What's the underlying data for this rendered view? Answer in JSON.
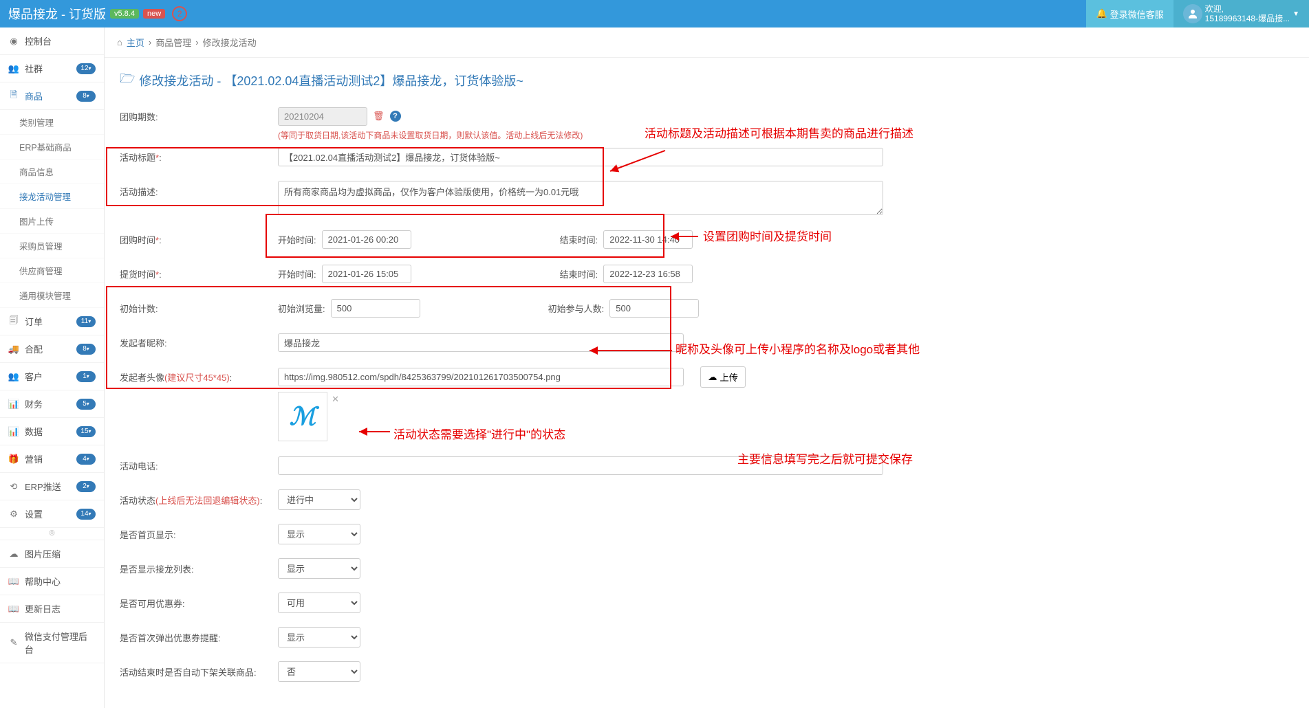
{
  "header": {
    "app_title": "爆品接龙 - 订货版",
    "version_badge": "v5.8.4",
    "new_badge": "new",
    "circle_badge": "2",
    "login_btn": "登录微信客服",
    "welcome": "欢迎,",
    "user_line": "15189963148-爆品接..."
  },
  "sidebar": {
    "items": [
      {
        "icon": "⊞",
        "label": "控制台",
        "badge": ""
      },
      {
        "icon": "👥",
        "label": "社群",
        "badge": "12"
      },
      {
        "icon": "🗎",
        "label": "商品",
        "badge": "8",
        "active": true
      },
      {
        "icon": "🗐",
        "label": "订单",
        "badge": "11"
      },
      {
        "icon": "🚚",
        "label": "合配",
        "badge": "8"
      },
      {
        "icon": "👥",
        "label": "客户",
        "badge": "1"
      },
      {
        "icon": "📊",
        "label": "财务",
        "badge": "5"
      },
      {
        "icon": "📊",
        "label": "数据",
        "badge": "15"
      },
      {
        "icon": "🎁",
        "label": "营销",
        "badge": "4"
      },
      {
        "icon": "⟲",
        "label": "ERP推送",
        "badge": "2"
      },
      {
        "icon": "⚙",
        "label": "设置",
        "badge": "14"
      }
    ],
    "subitems": [
      "类别管理",
      "ERP基础商品",
      "商品信息",
      "接龙活动管理",
      "图片上传",
      "采购员管理",
      "供应商管理",
      "通用模块管理"
    ],
    "bottom": [
      {
        "icon": "☁",
        "label": "图片压缩"
      },
      {
        "icon": "📖",
        "label": "帮助中心"
      },
      {
        "icon": "📖",
        "label": "更新日志"
      },
      {
        "icon": "✎",
        "label": "微信支付管理后台"
      }
    ]
  },
  "breadcrumb": {
    "home": "主页",
    "p1": "商品管理",
    "p2": "修改接龙活动"
  },
  "page_title": "修改接龙活动 - 【2021.02.04直播活动测试2】爆品接龙，订货体验版~",
  "form": {
    "period_label": "团购期数:",
    "period_value": "20210204",
    "period_note": "(等同于取货日期,该活动下商品未设置取货日期，则默认该值。活动上线后无法修改)",
    "title_label": "活动标题",
    "title_value": "【2021.02.04直播活动测试2】爆品接龙，订货体验版~",
    "desc_label": "活动描述:",
    "desc_value": "所有商家商品均为虚拟商品，仅作为客户体验版使用，价格统一为0.01元哦",
    "group_time_label": "团购时间",
    "start_label": "开始时间:",
    "end_label": "结束时间:",
    "group_start": "2021-01-26 00:20",
    "group_end": "2022-11-30 14:40",
    "pickup_label": "提货时间",
    "pickup_start": "2021-01-26 15:05",
    "pickup_end": "2022-12-23 16:58",
    "init_count_label": "初始计数:",
    "init_view_label": "初始浏览量:",
    "init_view_value": "500",
    "init_join_label": "初始参与人数:",
    "init_join_value": "500",
    "nick_label": "发起者昵称:",
    "nick_value": "爆品接龙",
    "avatar_label": "发起者头像",
    "avatar_hint": "(建议尺寸45*45)",
    "avatar_url": "https://img.980512.com/spdh/8425363799/202101261703500754.png",
    "upload_btn": "上传",
    "phone_label": "活动电话:",
    "status_label": "活动状态",
    "status_hint": "(上线后无法回退编辑状态)",
    "status_value": "进行中",
    "home_show_label": "是否首页显示:",
    "home_show_value": "显示",
    "list_show_label": "是否显示接龙列表:",
    "list_show_value": "显示",
    "coupon_label": "是否可用优惠券:",
    "coupon_value": "可用",
    "first_popup_label": "是否首次弹出优惠券提醒:",
    "first_popup_value": "显示",
    "auto_off_label": "活动结束时是否自动下架关联商品:",
    "auto_off_value": "否"
  },
  "annotations": {
    "a1": "活动标题及活动描述可根据本期售卖的商品进行描述",
    "a2": "设置团购时间及提货时间",
    "a3": "昵称及头像可上传小程序的名称及logo或者其他",
    "a4": "活动状态需要选择\"进行中\"的状态",
    "a5": "主要信息填写完之后就可提交保存"
  }
}
